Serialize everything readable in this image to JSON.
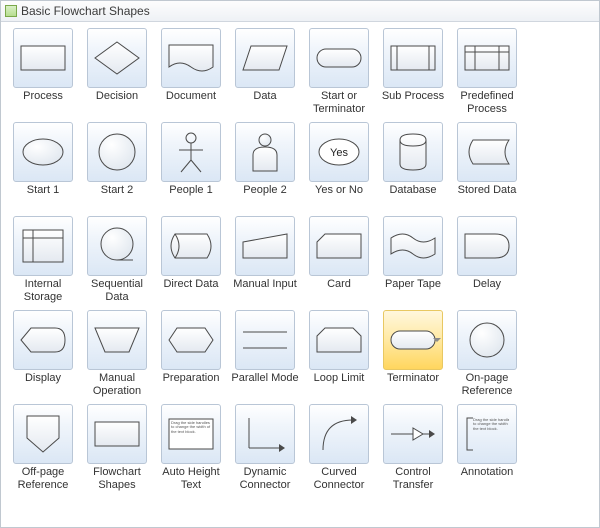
{
  "panel": {
    "title": "Basic Flowchart Shapes"
  },
  "microtext": {
    "auto_height": "Drag the side handles to change the width of the text block.",
    "annotation": "Drag the side handles to change the width of the text block."
  },
  "shapes": [
    {
      "id": "process",
      "label": "Process",
      "selected": false
    },
    {
      "id": "decision",
      "label": "Decision",
      "selected": false
    },
    {
      "id": "document",
      "label": "Document",
      "selected": false
    },
    {
      "id": "data",
      "label": "Data",
      "selected": false
    },
    {
      "id": "start_or_terminator",
      "label": "Start or Terminator",
      "selected": false
    },
    {
      "id": "sub_process",
      "label": "Sub Process",
      "selected": false
    },
    {
      "id": "predefined_process",
      "label": "Predefined Process",
      "selected": false
    },
    {
      "id": "start1",
      "label": "Start 1",
      "selected": false
    },
    {
      "id": "start2",
      "label": "Start 2",
      "selected": false
    },
    {
      "id": "people1",
      "label": "People 1",
      "selected": false
    },
    {
      "id": "people2",
      "label": "People 2",
      "selected": false
    },
    {
      "id": "yes_or_no",
      "label": "Yes or No",
      "selected": false,
      "inner_text": "Yes"
    },
    {
      "id": "database",
      "label": "Database",
      "selected": false
    },
    {
      "id": "stored_data",
      "label": "Stored Data",
      "selected": false
    },
    {
      "id": "internal_storage",
      "label": "Internal Storage",
      "selected": false
    },
    {
      "id": "sequential_data",
      "label": "Sequential Data",
      "selected": false
    },
    {
      "id": "direct_data",
      "label": "Direct Data",
      "selected": false
    },
    {
      "id": "manual_input",
      "label": "Manual Input",
      "selected": false
    },
    {
      "id": "card",
      "label": "Card",
      "selected": false
    },
    {
      "id": "paper_tape",
      "label": "Paper Tape",
      "selected": false
    },
    {
      "id": "delay",
      "label": "Delay",
      "selected": false
    },
    {
      "id": "display",
      "label": "Display",
      "selected": false
    },
    {
      "id": "manual_operation",
      "label": "Manual Operation",
      "selected": false
    },
    {
      "id": "preparation",
      "label": "Preparation",
      "selected": false
    },
    {
      "id": "parallel_mode",
      "label": "Parallel Mode",
      "selected": false
    },
    {
      "id": "loop_limit",
      "label": "Loop Limit",
      "selected": false
    },
    {
      "id": "terminator",
      "label": "Terminator",
      "selected": true
    },
    {
      "id": "on_page_reference",
      "label": "On-page Reference",
      "selected": false
    },
    {
      "id": "off_page_reference",
      "label": "Off-page Reference",
      "selected": false
    },
    {
      "id": "flowchart_shapes",
      "label": "Flowchart Shapes",
      "selected": false
    },
    {
      "id": "auto_height_text",
      "label": "Auto Height Text",
      "selected": false
    },
    {
      "id": "dynamic_connector",
      "label": "Dynamic Connector",
      "selected": false
    },
    {
      "id": "curved_connector",
      "label": "Curved Connector",
      "selected": false
    },
    {
      "id": "control_transfer",
      "label": "Control Transfer",
      "selected": false
    },
    {
      "id": "annotation",
      "label": "Annotation",
      "selected": false
    }
  ]
}
